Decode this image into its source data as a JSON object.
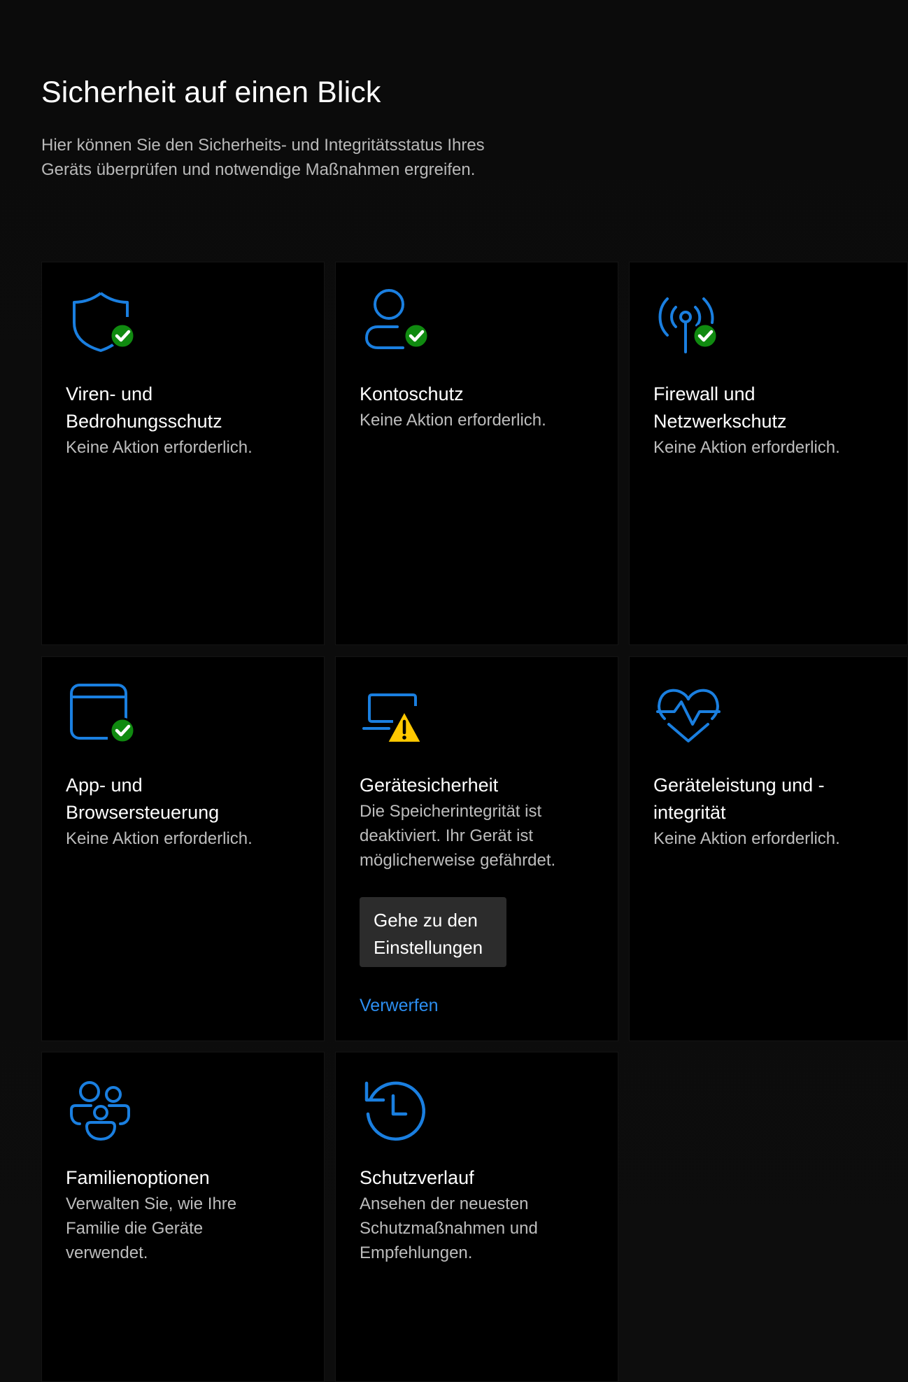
{
  "header": {
    "title": "Sicherheit auf einen Blick",
    "subtitle": "Hier können Sie den Sicherheits- und Integritätsstatus Ihres Geräts überprüfen und notwendige Maßnahmen ergreifen."
  },
  "colors": {
    "accent": "#1a7fe0",
    "ok": "#108a10",
    "warning": "#ffc800",
    "tile_bg": "#000000",
    "button_bg": "#2c2c2c",
    "link": "#2c8ef0"
  },
  "tiles": [
    {
      "title": "Viren- und Bedrohungsschutz",
      "title_line1": "Viren- und",
      "title_line2": "Bedrohungsschutz",
      "status": "Keine Aktion erforderlich.",
      "icon": "shield-icon",
      "badge": "check-badge-icon"
    },
    {
      "title": "Kontoschutz",
      "status": "Keine Aktion erforderlich.",
      "icon": "person-icon",
      "badge": "check-badge-icon"
    },
    {
      "title_line1": "Firewall und",
      "title_line2": "Netzwerkschutz",
      "status": "Keine Aktion erforderlich.",
      "icon": "wireless-antenna-icon",
      "badge": "check-badge-icon"
    },
    {
      "title_line1": "App- und",
      "title_line2": "Browsersteuerung",
      "status": "Keine Aktion erforderlich.",
      "icon": "browser-window-icon",
      "badge": "check-badge-icon"
    },
    {
      "title": "Gerätesicherheit",
      "status_line1": "Die Speicherintegrität ist",
      "status_line2": "deaktiviert. Ihr Gerät ist",
      "status_line3": "möglicherweise gefährdet.",
      "icon": "laptop-icon",
      "badge": "warning-badge-icon",
      "button_line1": "Gehe zu den",
      "button_line2": "Einstellungen",
      "link": "Verwerfen"
    },
    {
      "title_line1": "Geräteleistung und -",
      "title_line2": "integrität",
      "status": "Keine Aktion erforderlich.",
      "icon": "heart-pulse-icon"
    },
    {
      "title": "Familienoptionen",
      "status_line1": "Verwalten Sie, wie Ihre",
      "status_line2": "Familie die Geräte",
      "status_line3": "verwendet.",
      "icon": "family-icon"
    },
    {
      "title": "Schutzverlauf",
      "status_line1": "Ansehen der neuesten",
      "status_line2": "Schutzmaßnahmen und",
      "status_line3": "Empfehlungen.",
      "icon": "history-clock-icon"
    }
  ]
}
